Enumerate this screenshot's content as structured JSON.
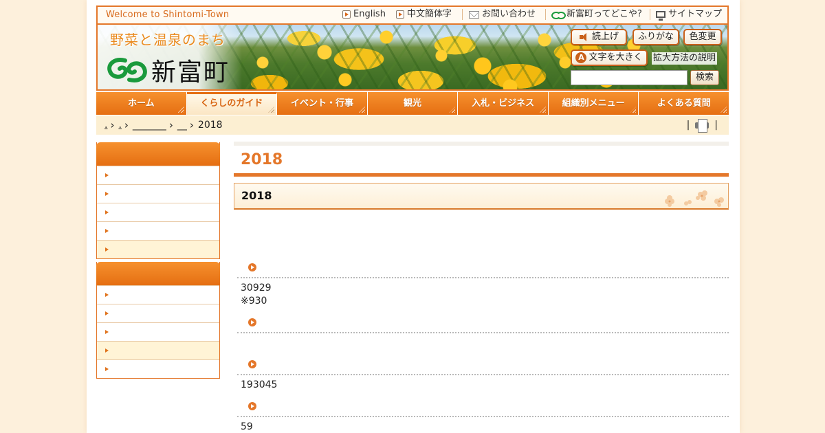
{
  "topbar": {
    "welcome": "Welcome to Shintomi-Town",
    "links": [
      {
        "label": "English",
        "icon": "play-icon"
      },
      {
        "label": "中文簡体字",
        "icon": "play-icon"
      },
      {
        "label": "お問い合わせ",
        "icon": "mail-icon"
      },
      {
        "label": "新富町ってどこや?",
        "icon": "town-logo-icon"
      },
      {
        "label": "サイトマップ",
        "icon": "monitor-icon"
      }
    ]
  },
  "header": {
    "tagline": "野菜と温泉のまち",
    "town_name": "新富町",
    "tools": {
      "read_aloud": "読上げ",
      "furigana": "ふりがな",
      "color_change": "色変更",
      "enlarge_text": "文字を大きく",
      "enlarge_help": "拡大方法の説明"
    },
    "search": {
      "placeholder": "",
      "button": "検索"
    },
    "colors": {
      "accent": "#e4772a",
      "logo_green": "#1a9a3c"
    }
  },
  "nav": {
    "items": [
      {
        "label": "ホーム"
      },
      {
        "label": "くらしのガイド"
      },
      {
        "label": "イベント・行事"
      },
      {
        "label": "観光"
      },
      {
        "label": "入札・ビジネス"
      },
      {
        "label": "組織別メニュー"
      },
      {
        "label": "よくある質問"
      }
    ],
    "active_index": 1
  },
  "breadcrumb": {
    "items": [
      ".",
      ".",
      "_______",
      "__"
    ],
    "current": "2018",
    "separator": "|"
  },
  "main": {
    "title": "2018",
    "subtitle": "2018",
    "entries": [
      {
        "text": ""
      },
      {
        "text": "30929\n※930"
      },
      {
        "text": ""
      },
      {
        "text": "193045"
      },
      {
        "text": "59"
      }
    ]
  }
}
